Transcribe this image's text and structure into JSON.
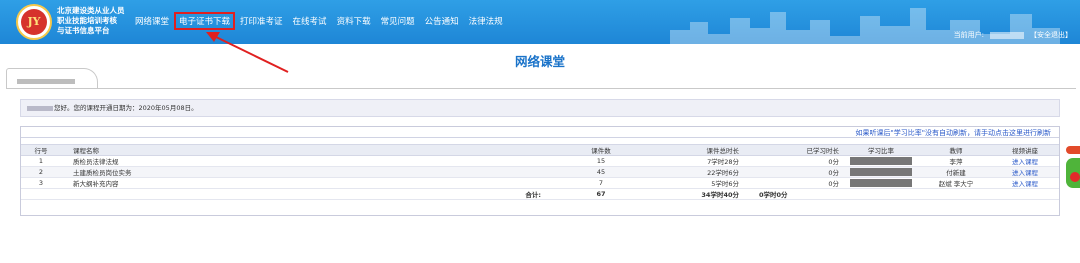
{
  "header": {
    "logo_text": "JY",
    "brand_lines": [
      "北京建设类从业人员",
      "职业技能培训考核",
      "与证书信息平台"
    ],
    "nav": [
      {
        "label": "网络课堂",
        "active": false
      },
      {
        "label": "电子证书下载",
        "active": true
      },
      {
        "label": "打印准考证",
        "active": false
      },
      {
        "label": "在线考试",
        "active": false
      },
      {
        "label": "资料下载",
        "active": false
      },
      {
        "label": "常见问题",
        "active": false
      },
      {
        "label": "公告通知",
        "active": false
      },
      {
        "label": "法律法规",
        "active": false
      }
    ],
    "current_user_label": "当前用户:",
    "logout_label": "【安全退出】"
  },
  "page": {
    "title": "网络课堂"
  },
  "notice": {
    "text": "您好。您的课程开通日期为：2020年05月08日。"
  },
  "courses": {
    "refresh_hint": "如果听课后\"学习比率\"没有自动刷新，请手动点击这里进行刷新",
    "headers": [
      "行号",
      "课程名称",
      "课件数",
      "课件总时长",
      "已学习时长",
      "学习比率",
      "教师",
      "视频讲座"
    ],
    "rows": [
      {
        "idx": "1",
        "name": "质检员法律法规",
        "count": "15",
        "total": "7学时28分",
        "learned": "0分",
        "teacher": "李萍",
        "video": "进入课程"
      },
      {
        "idx": "2",
        "name": "土建质检员岗位实务",
        "count": "45",
        "total": "22学时6分",
        "learned": "0分",
        "teacher": "付新建",
        "video": "进入课程"
      },
      {
        "idx": "3",
        "name": "新大纲补充内容",
        "count": "7",
        "total": "5学时6分",
        "learned": "0分",
        "teacher": "赵斌 李大宁",
        "video": "进入课程"
      }
    ],
    "total": {
      "label": "合计:",
      "count": "67",
      "total": "34学时40分",
      "learned": "0学时0分"
    }
  },
  "colors": {
    "header_blue": "#1e86d6",
    "title_blue": "#1a73c9",
    "highlight_red": "#e02020",
    "link_blue": "#2a59c9"
  }
}
